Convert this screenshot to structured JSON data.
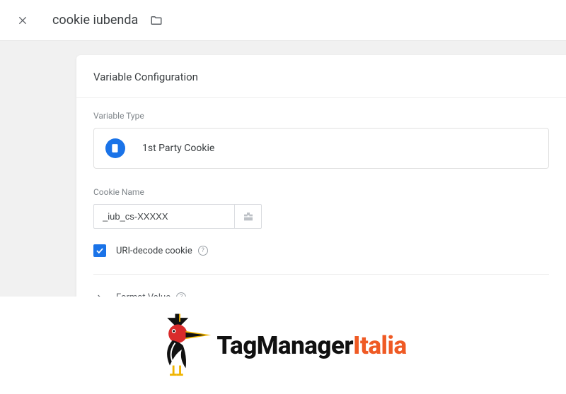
{
  "header": {
    "title": "cookie iubenda"
  },
  "card": {
    "title": "Variable Configuration",
    "variable_type_label": "Variable Type",
    "variable_type_value": "1st Party Cookie",
    "cookie_name_label": "Cookie Name",
    "cookie_name_value": "_iub_cs-XXXXX",
    "uri_decode_label": "URI-decode cookie",
    "format_value_label": "Format Value"
  },
  "logo": {
    "part1": "TagManager",
    "part2": "Italia"
  }
}
